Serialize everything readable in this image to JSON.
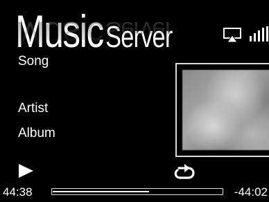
{
  "header": {
    "title_word1": "Music",
    "title_word2": "Server",
    "airplay_icon": "airplay-icon",
    "signal_icon": "signal-strength-icon"
  },
  "track": {
    "song": "Song",
    "artist": "Artist",
    "album": "Album",
    "art_icon": "album-art"
  },
  "controls": {
    "play_icon": "play-icon",
    "repeat_icon": "repeat-icon"
  },
  "progress": {
    "elapsed": "44:38",
    "remaining": "-44:02",
    "fraction": 0.57
  },
  "colors": {
    "background": "#000000",
    "foreground": "#ffffff",
    "frame": "#dddddd"
  }
}
